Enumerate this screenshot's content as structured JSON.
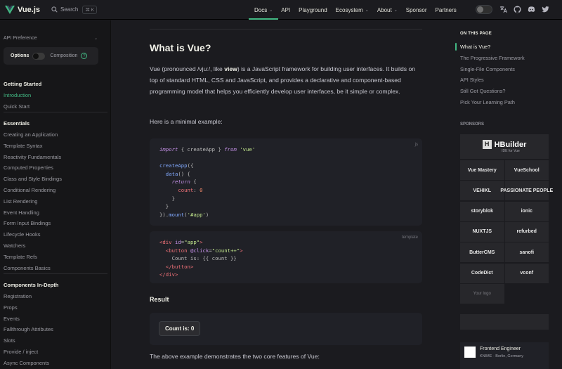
{
  "nav": {
    "brand": "Vue.js",
    "search_label": "Search",
    "search_kbd": "⌘ K",
    "links": [
      {
        "label": "Docs",
        "has_caret": true,
        "active": true
      },
      {
        "label": "API",
        "has_caret": false
      },
      {
        "label": "Playground",
        "has_caret": false
      },
      {
        "label": "Ecosystem",
        "has_caret": true
      },
      {
        "label": "About",
        "has_caret": true
      },
      {
        "label": "Sponsor",
        "has_caret": false
      },
      {
        "label": "Partners",
        "has_caret": false
      }
    ],
    "caret": "⌄",
    "icons": [
      "theme-switch",
      "translate-icon",
      "github-icon",
      "discord-icon",
      "twitter-icon"
    ]
  },
  "sidebar": {
    "api_preference": "API Preference",
    "api_caret": "⌄",
    "options_label": "Options",
    "composition_label": "Composition",
    "help": "?",
    "sections": [
      {
        "title": "Getting Started",
        "items": [
          "Introduction",
          "Quick Start"
        ],
        "active": "Introduction"
      },
      {
        "title": "Essentials",
        "items": [
          "Creating an Application",
          "Template Syntax",
          "Reactivity Fundamentals",
          "Computed Properties",
          "Class and Style Bindings",
          "Conditional Rendering",
          "List Rendering",
          "Event Handling",
          "Form Input Bindings",
          "Lifecycle Hooks",
          "Watchers",
          "Template Refs",
          "Components Basics"
        ]
      },
      {
        "title": "Components In-Depth",
        "items": [
          "Registration",
          "Props",
          "Events",
          "Fallthrough Attributes",
          "Slots",
          "Provide / inject",
          "Async Components"
        ]
      }
    ]
  },
  "main": {
    "title": "What is Vue?",
    "intro_pre": "Vue (pronounced /vjuː/, like ",
    "intro_bold": "view",
    "intro_post": ") is a JavaScript framework for building user interfaces. It builds on top of standard HTML, CSS and JavaScript, and provides a declarative and component-based programming model that helps you efficiently develop user interfaces, be it simple or complex.",
    "example_text": "Here is a minimal example:",
    "code_js_lang": "js",
    "code_template_lang": "template",
    "result_title": "Result",
    "count_button": "Count is: 0",
    "outro": "The above example demonstrates the two core features of Vue:"
  },
  "aside": {
    "on_this_page": "ON THIS PAGE",
    "toc": [
      "What is Vue?",
      "The Progressive Framework",
      "Single-File Components",
      "API Styles",
      "Still Got Questions?",
      "Pick Your Learning Path"
    ],
    "sponsors_title": "SPONSORS",
    "hbuilder_name": "HBuilder",
    "hbuilder_mark": "H",
    "hbuilder_sub": "IDE for Vue",
    "sponsors": [
      "Vue Mastery",
      "VueSchool",
      "VEHIKL",
      "PASSIONATE PEOPLE",
      "storyblok",
      "ionic",
      "NUXTJS",
      "refurbed",
      "ButterCMS",
      "sanofi",
      "CodeDict",
      "vconf",
      "Your logo"
    ],
    "job_title": "Frontend Engineer",
    "job_location": "KNIME · Berlin, Germany"
  },
  "colors": {
    "accent": "#42b883",
    "bg": "#1b1b1f",
    "sidebar_bg": "#161618",
    "code_bg": "#202127"
  }
}
